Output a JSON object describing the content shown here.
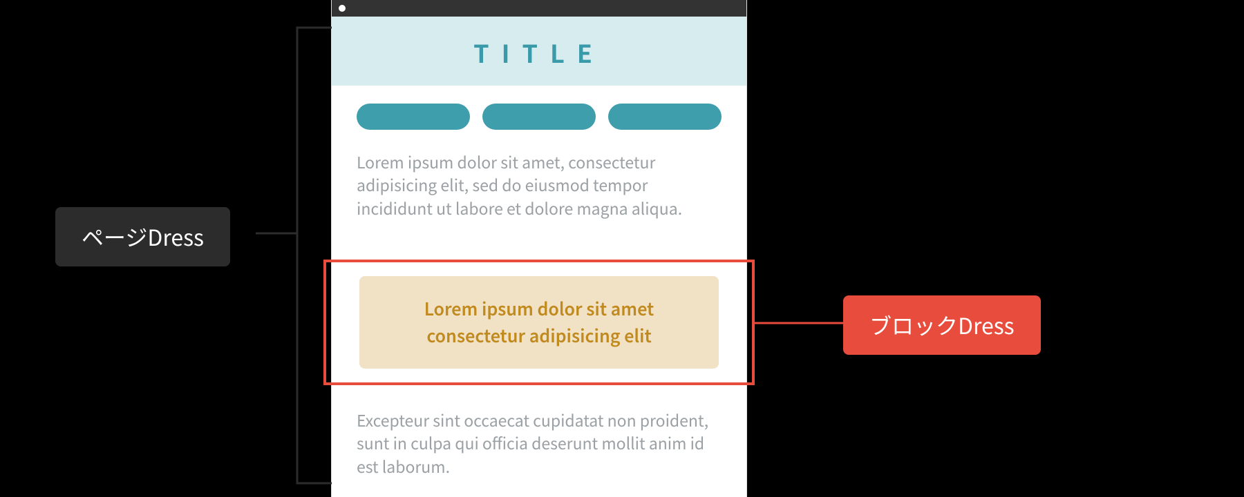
{
  "labels": {
    "page_dress": "ページDress",
    "block_dress": "ブロックDress"
  },
  "mockup": {
    "title": "TITLE",
    "paragraph_top": "Lorem ipsum dolor sit amet, consectetur adipisicing elit, sed do eiusmod tempor incididunt ut labore et dolore magna aliqua.",
    "highlight_line1": "Lorem ipsum dolor sit amet",
    "highlight_line2": "consectetur adipisicing elit",
    "paragraph_bottom": "Excepteur sint occaecat cupidatat non proident, sunt in culpa qui officia deserunt mollit anim id est laborum."
  },
  "colors": {
    "page_label_bg": "#2c2c2c",
    "block_label_bg": "#e74c3c",
    "title_bg": "#d6ecef",
    "title_fg": "#3a9aa9",
    "pill": "#3f9eac",
    "highlight_bg": "#f2e2c5",
    "highlight_fg": "#c08a1f",
    "body_text": "#9aa0a3"
  }
}
